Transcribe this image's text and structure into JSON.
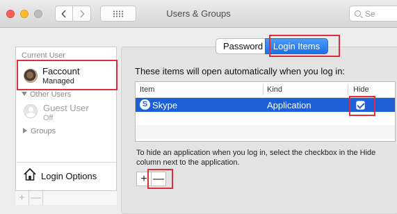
{
  "window": {
    "title": "Users & Groups",
    "search_placeholder": "Se"
  },
  "sidebar": {
    "header": "Current User",
    "current_user": {
      "name": "Faccount",
      "role": "Managed"
    },
    "other_users_header": "Other Users",
    "guest": {
      "name": "Guest User",
      "status": "Off"
    },
    "groups_label": "Groups",
    "login_options_label": "Login Options",
    "add_label": "+",
    "remove_label": "—"
  },
  "tabs": [
    {
      "label": "Password",
      "selected": false
    },
    {
      "label": "Login Items",
      "selected": true
    }
  ],
  "main": {
    "intro": "These items will open automatically when you log in:",
    "columns": [
      "Item",
      "Kind",
      "Hide"
    ],
    "rows": [
      {
        "item": "Skype",
        "kind": "Application",
        "hide": true,
        "icon": "skype-icon",
        "selected": true
      }
    ],
    "help_line1": "To hide an application when you log in, select the checkbox in the Hide",
    "help_line2": "column next to the application.",
    "add_label": "+",
    "remove_label": "—"
  },
  "colors": {
    "accent": "#1c5fd8",
    "highlight": "#e02d3a"
  }
}
